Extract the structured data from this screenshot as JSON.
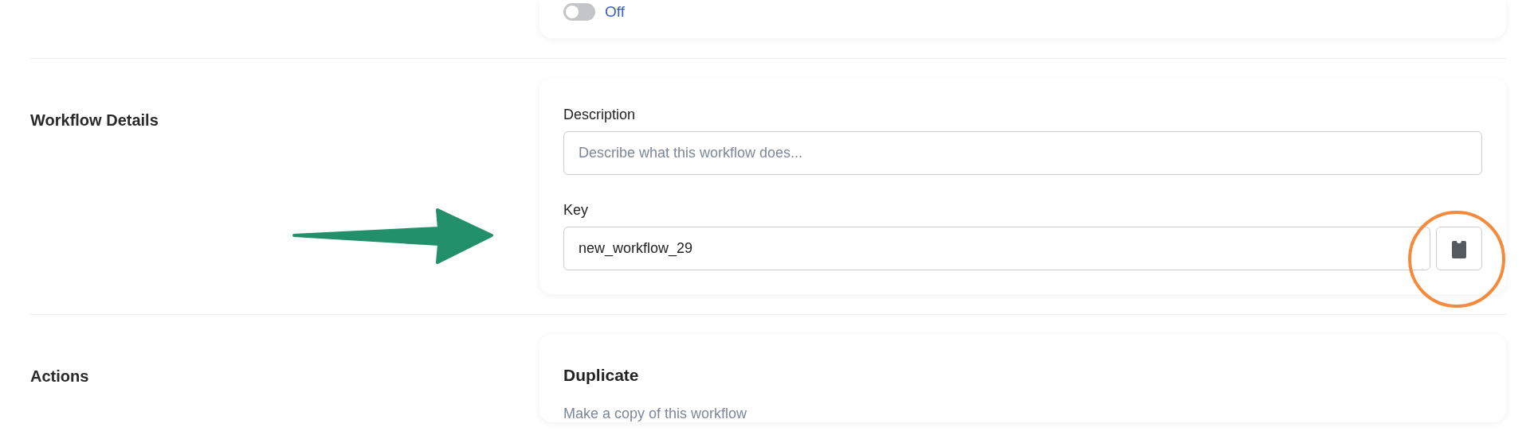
{
  "status_toggle": {
    "on": false,
    "label": "Off"
  },
  "workflow_details": {
    "title": "Workflow Details",
    "description": {
      "label": "Description",
      "placeholder": "Describe what this workflow does..."
    },
    "key": {
      "label": "Key",
      "value": "new_workflow_29"
    }
  },
  "actions": {
    "title": "Actions",
    "items": [
      {
        "heading": "Duplicate",
        "text": "Make a copy of this workflow"
      }
    ]
  }
}
